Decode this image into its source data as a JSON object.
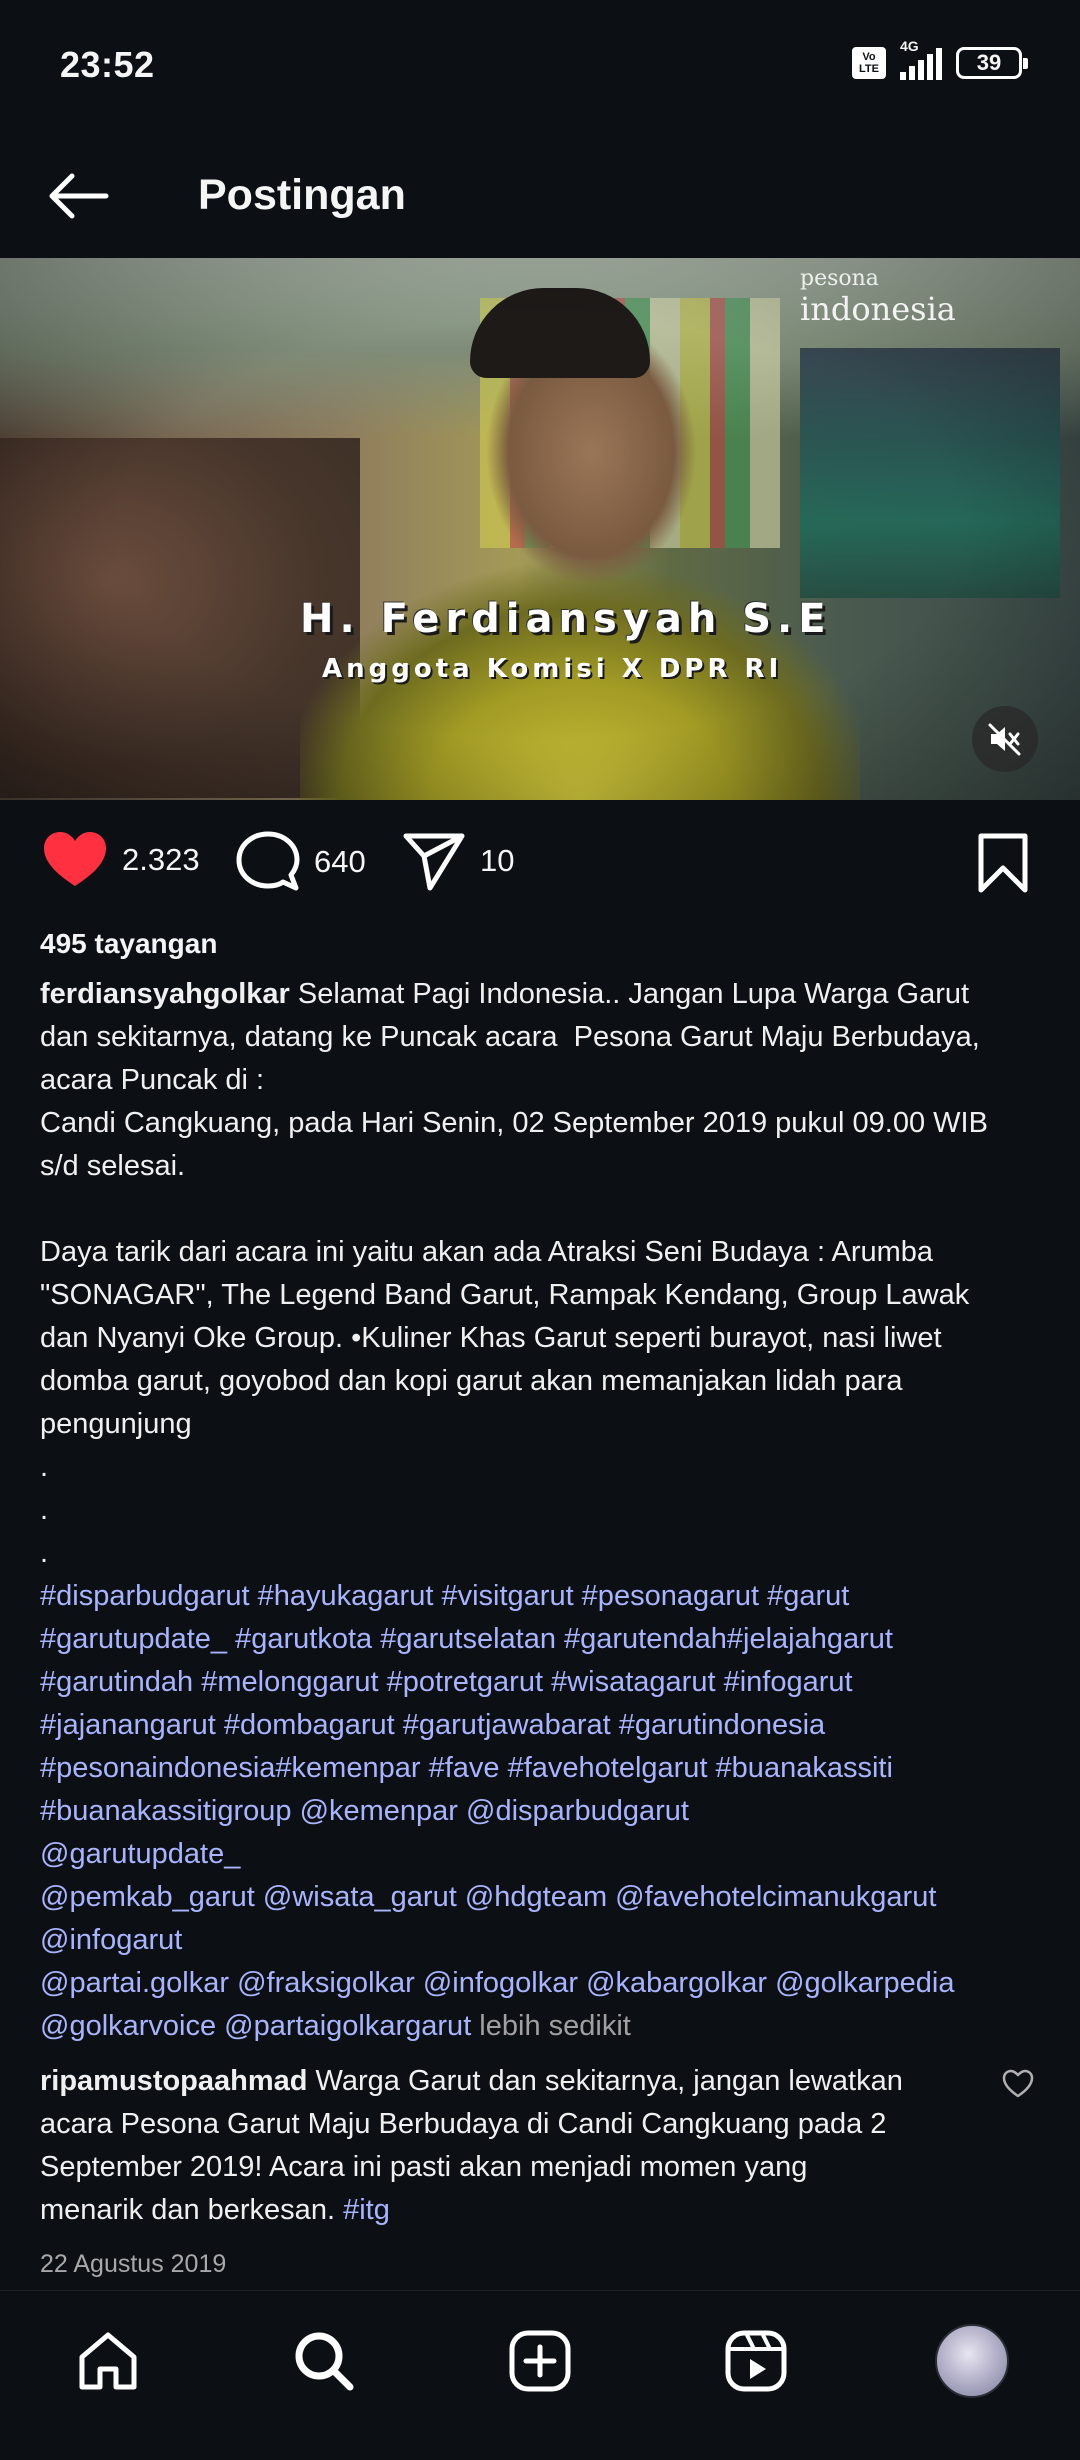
{
  "status_bar": {
    "time": "23:52",
    "volte_label": "Vo\nLTE",
    "network": "4G",
    "battery": "39"
  },
  "header": {
    "title": "Postingan",
    "back_icon": "arrow-left-icon"
  },
  "media": {
    "name_overlay": "H. Ferdiansyah S.E",
    "role_overlay": "Anggota Komisi X DPR RI",
    "watermark_top": "pesona",
    "watermark_main": "indonesia",
    "mute_icon": "volume-muted-icon"
  },
  "actions": {
    "likes": "2.323",
    "comments": "640",
    "shares": "10",
    "like_color": "#ff3040"
  },
  "views": "495 tayangan",
  "caption": {
    "username": "ferdiansyahgolkar",
    "text": " Selamat Pagi Indonesia.. Jangan Lupa Warga Garut\ndan sekitarnya, datang ke Puncak acara  Pesona Garut Maju Berbudaya,\nacara Puncak di :\nCandi Cangkuang, pada Hari Senin, 02 September 2019 pukul 09.00 WIB\ns/d selesai.\n\nDaya tarik dari acara ini yaitu akan ada Atraksi Seni Budaya : Arumba\n\"SONAGAR\", The Legend Band Garut, Rampak Kendang, Group Lawak\ndan Nyanyi Oke Group. •Kuliner Khas Garut seperti burayot, nasi liwet\ndomba garut, goyobod dan kopi garut akan memanjakan lidah para\npengunjung\n.\n.\n."
  },
  "hashtag_lines": [
    "#disparbudgarut #hayukagarut #visitgarut #pesonagarut #garut",
    "#garutupdate_ #garutkota #garutselatan #garutendah#jelajahgarut",
    "#garutindah #melonggarut #potretgarut #wisatagarut #infogarut",
    "#jajanangarut #dombagarut #garutjawabarat #garutindonesia",
    "#pesonaindonesia#kemenpar #fave #favehotelgarut #buanakassiti",
    "#buanakassitigroup @kemenpar @disparbudgarut",
    "@garutupdate_",
    "@pemkab_garut @wisata_garut @hdgteam @favehotelcimanukgarut",
    "@infogarut",
    "@partai.golkar @fraksigolkar @infogolkar @kabargolkar @golkarpedia"
  ],
  "hashtag_last_line": "@golkarvoice @partaigolkargarut",
  "less_label": " lebih sedikit",
  "comment": {
    "username": "ripamustopaahmad",
    "text": " Warga Garut dan sekitarnya, jangan lewatkan\nacara Pesona Garut Maju Berbudaya di Candi Cangkuang pada 2\nSeptember 2019! Acara ini pasti akan menjadi momen yang\nmenarik dan berkesan. ",
    "tag": "#itg"
  },
  "post_date": "22 Agustus 2019",
  "nav": {
    "items": [
      "home-icon",
      "search-icon",
      "create-icon",
      "reels-icon",
      "profile-avatar"
    ]
  }
}
